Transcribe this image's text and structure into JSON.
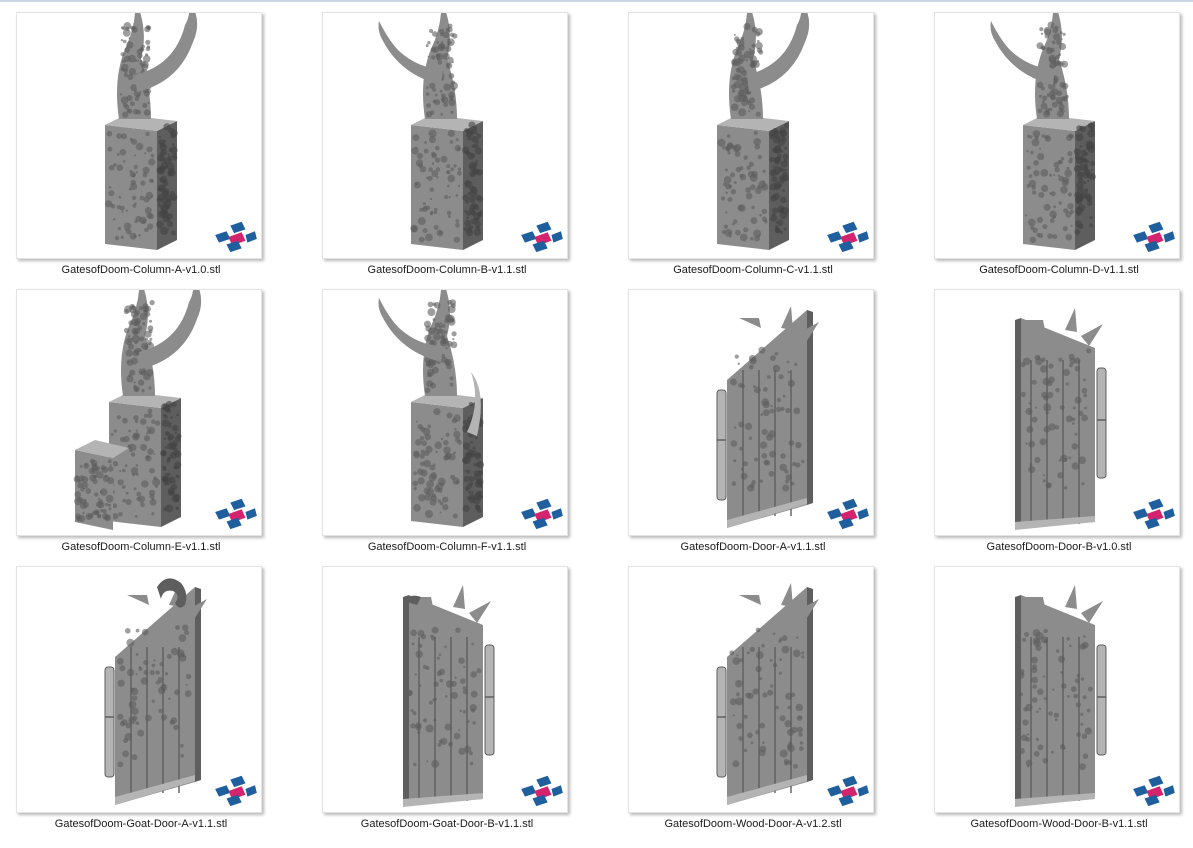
{
  "files": [
    {
      "name": "GatesofDoom-Column-A-v1.0.stl",
      "kind": "column",
      "variant": "a"
    },
    {
      "name": "GatesofDoom-Column-B-v1.1.stl",
      "kind": "column",
      "variant": "b"
    },
    {
      "name": "GatesofDoom-Column-C-v1.1.stl",
      "kind": "column",
      "variant": "a"
    },
    {
      "name": "GatesofDoom-Column-D-v1.1.stl",
      "kind": "column",
      "variant": "b"
    },
    {
      "name": "GatesofDoom-Column-E-v1.1.stl",
      "kind": "column",
      "variant": "e"
    },
    {
      "name": "GatesofDoom-Column-F-v1.1.stl",
      "kind": "column",
      "variant": "f"
    },
    {
      "name": "GatesofDoom-Door-A-v1.1.stl",
      "kind": "door",
      "variant": "a"
    },
    {
      "name": "GatesofDoom-Door-B-v1.0.stl",
      "kind": "door",
      "variant": "b"
    },
    {
      "name": "GatesofDoom-Goat-Door-A-v1.1.stl",
      "kind": "door",
      "variant": "goat-a"
    },
    {
      "name": "GatesofDoom-Goat-Door-B-v1.1.stl",
      "kind": "door",
      "variant": "goat-b"
    },
    {
      "name": "GatesofDoom-Wood-Door-A-v1.2.stl",
      "kind": "door",
      "variant": "a"
    },
    {
      "name": "GatesofDoom-Wood-Door-B-v1.1.stl",
      "kind": "door",
      "variant": "b"
    }
  ],
  "icons": {
    "thumbnail_badge": "stl-viewer-logo-icon"
  },
  "colors": {
    "model_gray": "#8c8c8c",
    "model_dark": "#5e5e5e",
    "model_light": "#b4b4b4",
    "badge_blue": "#1f5f9e",
    "badge_magenta": "#d4246e",
    "badge_white": "#f4f4f4"
  }
}
